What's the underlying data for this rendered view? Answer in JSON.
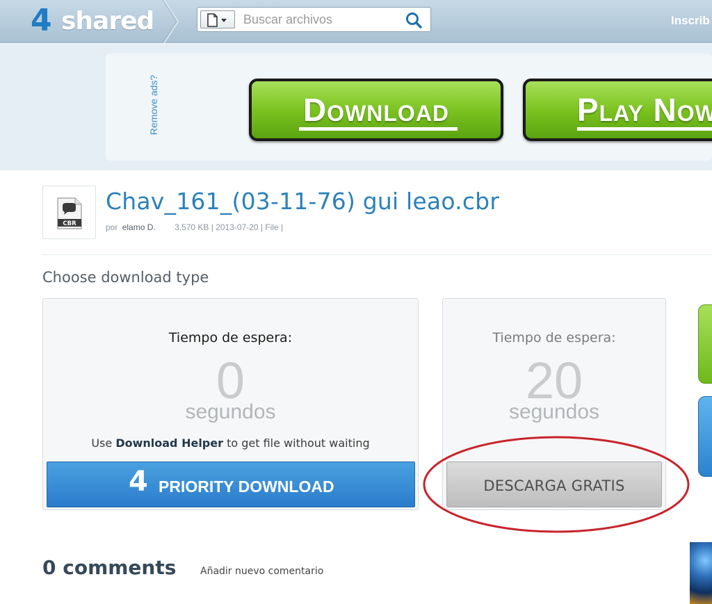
{
  "header": {
    "logo_number": "4",
    "logo_word": "shared",
    "search_placeholder": "Buscar archivos",
    "signup_label": "Inscrib"
  },
  "ad_band": {
    "remove_ads": "Remove ads?",
    "download_label": "Download",
    "play_label": "Play Now"
  },
  "file": {
    "name": "Chav_161_(03-11-76) gui leao.cbr",
    "icon_label": "CBR",
    "by_prefix": "por",
    "owner": "elamo D.",
    "info": "3,570 KB | 2013-07-20 | File |"
  },
  "download": {
    "heading": "Choose download type",
    "priority": {
      "wait_label": "Tiempo de espera:",
      "seconds": "0",
      "unit": "segundos",
      "helper_prefix": "Use",
      "helper_link": "Download Helper",
      "helper_suffix": "to get file without waiting",
      "button_number": "4",
      "button_label": "PRIORITY DOWNLOAD"
    },
    "free": {
      "wait_label": "Tiempo de espera:",
      "seconds": "20",
      "unit": "segundos",
      "button_label": "DESCARGA GRATIS"
    }
  },
  "comments": {
    "count_label": "0 comments",
    "add_label": "Añadir nuevo comentario"
  },
  "colors": {
    "accent_blue": "#2b81bb",
    "header_bg": "#b8cedd",
    "ad_green": "#7cc321",
    "priority_blue": "#3a8fd6",
    "annotation_red": "#c8232b"
  }
}
